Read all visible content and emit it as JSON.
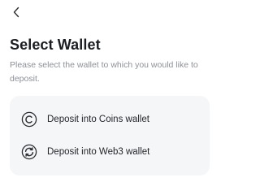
{
  "header": {
    "back_icon": "chevron-left-icon",
    "title": "Select Wallet",
    "subtitle": "Please select the wallet to which you would like to deposit."
  },
  "options": [
    {
      "label": "Deposit into Coins wallet",
      "icon": "coins-copyright-icon"
    },
    {
      "label": "Deposit into Web3 wallet",
      "icon": "web3-sync-icon"
    }
  ],
  "colors": {
    "title": "#1a1d22",
    "subtitle": "#8c9099",
    "card_background": "#f5f6f8",
    "icon": "#2b2e33"
  }
}
